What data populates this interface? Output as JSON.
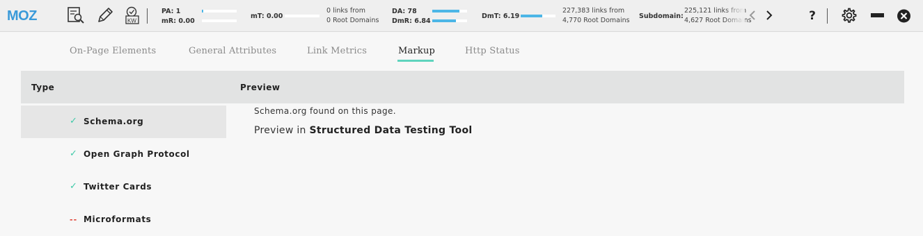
{
  "toolbar": {
    "logo_text": "MOZ",
    "icons": {
      "page_analysis": "page-search-icon",
      "highlight": "pencil-icon",
      "keyword": "kw-checklist-icon"
    },
    "metrics": {
      "pa_label": "PA: 1",
      "mr_label": "mR: 0.00",
      "mt_label": "mT: 0.00",
      "page_links": "0 links from",
      "page_root_domains": "0 Root Domains",
      "da_label": "DA: 78",
      "dmr_label": "DmR: 6.84",
      "dmt_label": "DmT: 6.19",
      "domain_links": "227,383 links from",
      "domain_root_domains": "4,770 Root Domains",
      "subdomain_label": "Subdomain:",
      "subdomain_links": "225,121 links from",
      "subdomain_root_domains": "4,627 Root Domains",
      "pa_fill": 0.01,
      "mr_fill": 0.0,
      "mt_fill": 0.0,
      "da_fill": 0.78,
      "dmr_fill": 0.68,
      "dmt_fill": 0.62
    },
    "right_icons": {
      "help": "?",
      "settings": "gear-icon",
      "collapse": "minimize-bar-icon",
      "close": "close-icon"
    },
    "accent": "#4cb6e6"
  },
  "tabs": [
    {
      "label": "On-Page Elements",
      "active": false
    },
    {
      "label": "General Attributes",
      "active": false
    },
    {
      "label": "Link Metrics",
      "active": false
    },
    {
      "label": "Markup",
      "active": true
    },
    {
      "label": "Http Status",
      "active": false
    }
  ],
  "table": {
    "type_header": "Type",
    "preview_header": "Preview",
    "rows": [
      {
        "mark": "✓",
        "status": "ok",
        "label": "Schema.org",
        "selected": true
      },
      {
        "mark": "✓",
        "status": "ok",
        "label": "Open Graph Protocol",
        "selected": false
      },
      {
        "mark": "✓",
        "status": "ok",
        "label": "Twitter Cards",
        "selected": false
      },
      {
        "mark": "--",
        "status": "missing",
        "label": "Microformats",
        "selected": false
      }
    ]
  },
  "preview": {
    "found_text": "Schema.org found on this page.",
    "prefix": "Preview in",
    "link_text": "Structured Data Testing Tool"
  },
  "colors": {
    "tab_active_underline": "#5fd4bd",
    "check": "#3fc9a8",
    "missing": "#e0392c"
  }
}
